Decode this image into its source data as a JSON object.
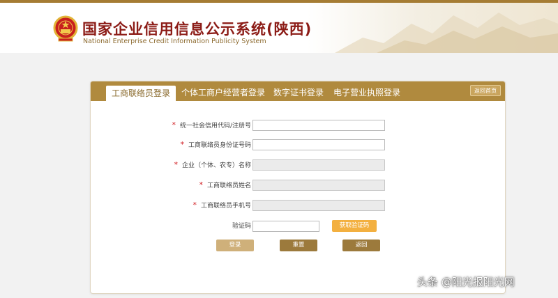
{
  "header": {
    "title_cn": "国家企业信用信息公示系统(陕西)",
    "title_en": "National Enterprise Credit Information Publicity System",
    "emblem_icon": "national-emblem-icon"
  },
  "tabs": [
    {
      "label": "工商联络员登录",
      "active": true
    },
    {
      "label": "个体工商户经营者登录",
      "active": false
    },
    {
      "label": "数字证书登录",
      "active": false
    },
    {
      "label": "电子营业执照登录",
      "active": false
    }
  ],
  "back_home_label": "返回首页",
  "form": {
    "required_mark": "*",
    "fields": [
      {
        "label": "统一社会信用代码/注册号",
        "value": "",
        "disabled": false
      },
      {
        "label": "工商联络员身份证号码",
        "value": "",
        "disabled": false
      },
      {
        "label": "企业（个体、农专）名称",
        "value": "",
        "disabled": true
      },
      {
        "label": "工商联络员姓名",
        "value": "",
        "disabled": true
      },
      {
        "label": "工商联络员手机号",
        "value": "",
        "disabled": true
      }
    ],
    "captcha_label": "验证码",
    "captcha_value": "",
    "get_code_label": "获取验证码",
    "login_label": "登录",
    "reset_label": "重置",
    "back_label": "返回"
  },
  "watermark": "头条 @阳光报阳光网",
  "colors": {
    "accent": "#b08a3e",
    "title_red": "#8c1c17",
    "required_red": "#d0161c",
    "get_code_orange": "#f3b040"
  }
}
